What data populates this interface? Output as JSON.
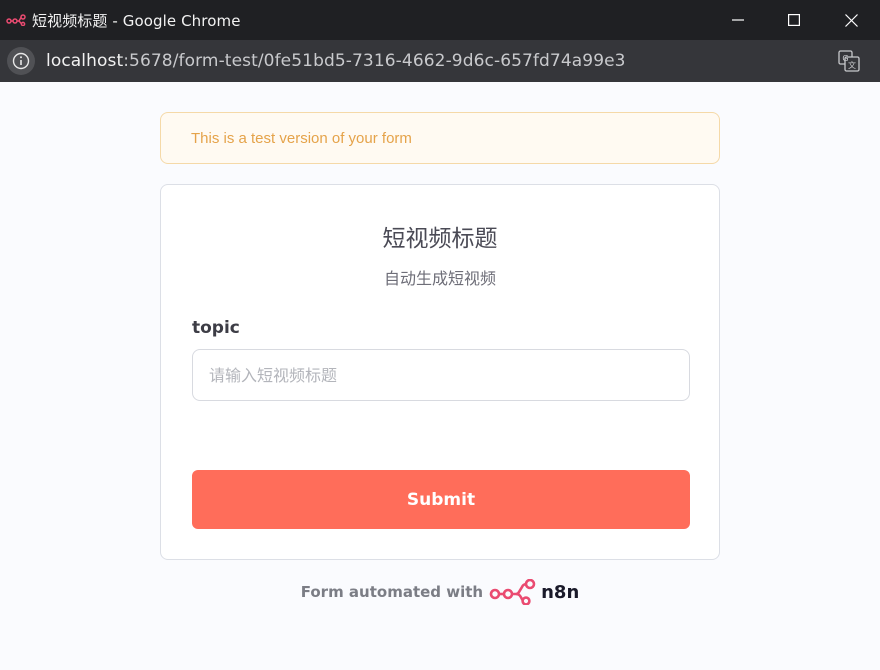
{
  "window": {
    "title": "短视频标题 - Google Chrome",
    "app_icon": "n8n-logo-icon"
  },
  "addressbar": {
    "url_host": "localhost",
    "url_rest": ":5678/form-test/0fe51bd5-7316-4662-9d6c-657fd74a99e3",
    "site_info_icon": "info-icon",
    "translate_icon": "translate-icon"
  },
  "banner": {
    "text": "This is a test version of your form"
  },
  "form": {
    "title": "短视频标题",
    "subtitle": "自动生成短视频",
    "field_label": "topic",
    "field_placeholder": "请输入短视频标题",
    "field_value": "",
    "submit_label": "Submit"
  },
  "footer": {
    "automated_text": "Form automated with",
    "brand": "n8n"
  },
  "colors": {
    "accent": "#ff6d5a",
    "banner_text": "#e5a34a",
    "banner_bg": "#fffaf2",
    "brand_pink": "#ea4b71"
  }
}
